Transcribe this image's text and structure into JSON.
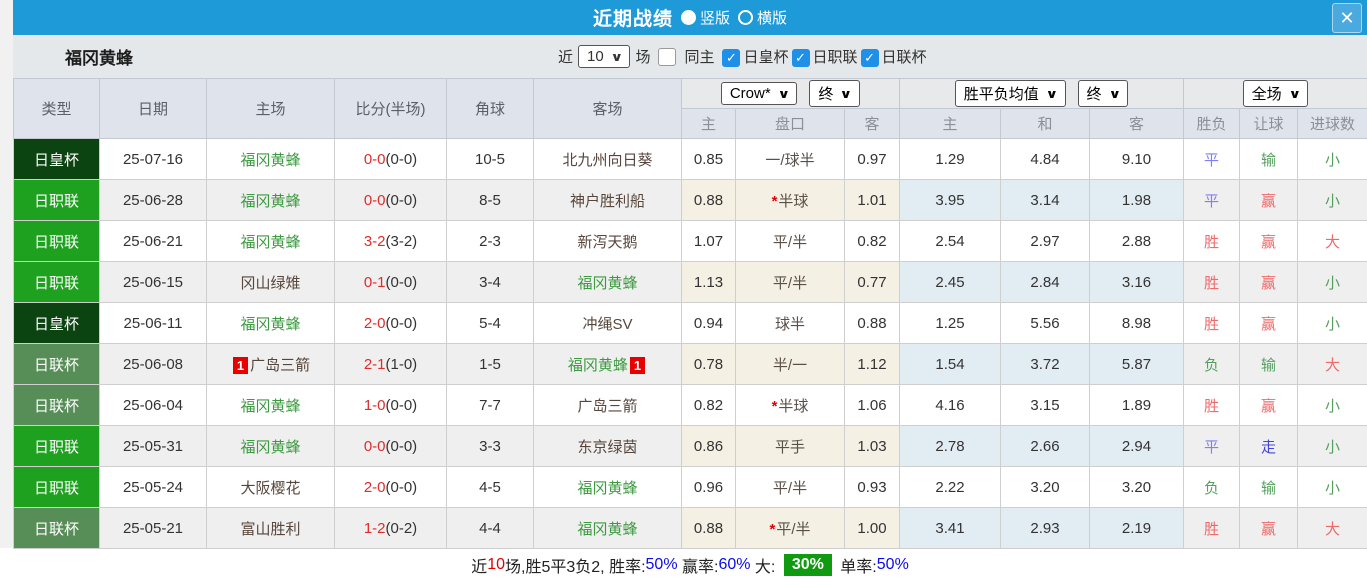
{
  "titlebar": {
    "title": "近期战绩",
    "radio_vertical": "竖版",
    "radio_horizontal": "横版",
    "close_icon": "✕"
  },
  "toolbar": {
    "team": "福冈黄蜂",
    "recent_label": "近",
    "count_value": "10",
    "matches_label": "场",
    "same_home_label": "同主",
    "filters": [
      {
        "label": "日皇杯",
        "checked": true
      },
      {
        "label": "日职联",
        "checked": true
      },
      {
        "label": "日联杯",
        "checked": true
      }
    ]
  },
  "table": {
    "left_headers": [
      "类型",
      "日期",
      "主场",
      "比分(半场)",
      "角球",
      "客场"
    ],
    "dropdowns": {
      "company": "Crow*",
      "company_time": "终",
      "europe": "胜平负均值",
      "europe_time": "终",
      "scope": "全场"
    },
    "sub_headers": [
      "主",
      "盘口",
      "客",
      "主",
      "和",
      "客",
      "胜负",
      "让球",
      "进球数"
    ],
    "badge_text": "1",
    "colors": {
      "cup_dark_badge": "#0b4410",
      "league_badge": "#1ea11e",
      "cup_light_badge": "#578e57",
      "self_team": "#3c9a40",
      "win_red": "#ef6a6a",
      "lose_green": "#55a05f",
      "draw_blue": "#8080f0",
      "push_purple": "#4444dd"
    },
    "rows": [
      {
        "type": "日皇杯",
        "type_class": "dark",
        "date": "25-07-16",
        "home": {
          "name": "福冈黄蜂",
          "self": true,
          "badge": false
        },
        "score": "0-0",
        "half": "(0-0)",
        "corner": "10-5",
        "away": {
          "name": "北九州向日葵",
          "self": false,
          "badge": false
        },
        "ah_home": "0.85",
        "ah_line": "一/球半",
        "ah_star": false,
        "ah_away": "0.97",
        "avg_home": "1.29",
        "avg_draw": "4.84",
        "avg_away": "9.10",
        "result": {
          "text": "平",
          "cls": "blue"
        },
        "handicap": {
          "text": "输",
          "cls": "green"
        },
        "goals": {
          "text": "小",
          "cls": "green"
        }
      },
      {
        "type": "日职联",
        "type_class": "bright",
        "date": "25-06-28",
        "home": {
          "name": "福冈黄蜂",
          "self": true,
          "badge": false
        },
        "score": "0-0",
        "half": "(0-0)",
        "corner": "8-5",
        "away": {
          "name": "神户胜利船",
          "self": false,
          "badge": false
        },
        "ah_home": "0.88",
        "ah_line": "半球",
        "ah_star": true,
        "ah_away": "1.01",
        "avg_home": "3.95",
        "avg_draw": "3.14",
        "avg_away": "1.98",
        "result": {
          "text": "平",
          "cls": "blue"
        },
        "handicap": {
          "text": "赢",
          "cls": "red"
        },
        "goals": {
          "text": "小",
          "cls": "green"
        }
      },
      {
        "type": "日职联",
        "type_class": "bright",
        "date": "25-06-21",
        "home": {
          "name": "福冈黄蜂",
          "self": true,
          "badge": false
        },
        "score": "3-2",
        "half": "(3-2)",
        "corner": "2-3",
        "away": {
          "name": "新泻天鹅",
          "self": false,
          "badge": false
        },
        "ah_home": "1.07",
        "ah_line": "平/半",
        "ah_star": false,
        "ah_away": "0.82",
        "avg_home": "2.54",
        "avg_draw": "2.97",
        "avg_away": "2.88",
        "result": {
          "text": "胜",
          "cls": "red"
        },
        "handicap": {
          "text": "赢",
          "cls": "red"
        },
        "goals": {
          "text": "大",
          "cls": "red"
        }
      },
      {
        "type": "日职联",
        "type_class": "bright",
        "date": "25-06-15",
        "home": {
          "name": "冈山绿雉",
          "self": false,
          "badge": false
        },
        "score": "0-1",
        "half": "(0-0)",
        "corner": "3-4",
        "away": {
          "name": "福冈黄蜂",
          "self": true,
          "badge": false
        },
        "ah_home": "1.13",
        "ah_line": "平/半",
        "ah_star": false,
        "ah_away": "0.77",
        "avg_home": "2.45",
        "avg_draw": "2.84",
        "avg_away": "3.16",
        "result": {
          "text": "胜",
          "cls": "red"
        },
        "handicap": {
          "text": "赢",
          "cls": "red"
        },
        "goals": {
          "text": "小",
          "cls": "green"
        }
      },
      {
        "type": "日皇杯",
        "type_class": "dark",
        "date": "25-06-11",
        "home": {
          "name": "福冈黄蜂",
          "self": true,
          "badge": false
        },
        "score": "2-0",
        "half": "(0-0)",
        "corner": "5-4",
        "away": {
          "name": "冲绳SV",
          "self": false,
          "badge": false
        },
        "ah_home": "0.94",
        "ah_line": "球半",
        "ah_star": false,
        "ah_away": "0.88",
        "avg_home": "1.25",
        "avg_draw": "5.56",
        "avg_away": "8.98",
        "result": {
          "text": "胜",
          "cls": "red"
        },
        "handicap": {
          "text": "赢",
          "cls": "red"
        },
        "goals": {
          "text": "小",
          "cls": "green"
        }
      },
      {
        "type": "日联杯",
        "type_class": "light",
        "date": "25-06-08",
        "home": {
          "name": "广岛三箭",
          "self": false,
          "badge": true
        },
        "score": "2-1",
        "half": "(1-0)",
        "corner": "1-5",
        "away": {
          "name": "福冈黄蜂",
          "self": true,
          "badge": true
        },
        "ah_home": "0.78",
        "ah_line": "半/一",
        "ah_star": false,
        "ah_away": "1.12",
        "avg_home": "1.54",
        "avg_draw": "3.72",
        "avg_away": "5.87",
        "result": {
          "text": "负",
          "cls": "green"
        },
        "handicap": {
          "text": "输",
          "cls": "green"
        },
        "goals": {
          "text": "大",
          "cls": "red"
        }
      },
      {
        "type": "日联杯",
        "type_class": "light",
        "date": "25-06-04",
        "home": {
          "name": "福冈黄蜂",
          "self": true,
          "badge": false
        },
        "score": "1-0",
        "half": "(0-0)",
        "corner": "7-7",
        "away": {
          "name": "广岛三箭",
          "self": false,
          "badge": false
        },
        "ah_home": "0.82",
        "ah_line": "半球",
        "ah_star": true,
        "ah_away": "1.06",
        "avg_home": "4.16",
        "avg_draw": "3.15",
        "avg_away": "1.89",
        "result": {
          "text": "胜",
          "cls": "red"
        },
        "handicap": {
          "text": "赢",
          "cls": "red"
        },
        "goals": {
          "text": "小",
          "cls": "green"
        }
      },
      {
        "type": "日职联",
        "type_class": "bright",
        "date": "25-05-31",
        "home": {
          "name": "福冈黄蜂",
          "self": true,
          "badge": false
        },
        "score": "0-0",
        "half": "(0-0)",
        "corner": "3-3",
        "away": {
          "name": "东京绿茵",
          "self": false,
          "badge": false
        },
        "ah_home": "0.86",
        "ah_line": "平手",
        "ah_star": false,
        "ah_away": "1.03",
        "avg_home": "2.78",
        "avg_draw": "2.66",
        "avg_away": "2.94",
        "result": {
          "text": "平",
          "cls": "blue"
        },
        "handicap": {
          "text": "走",
          "cls": "purple"
        },
        "goals": {
          "text": "小",
          "cls": "green"
        }
      },
      {
        "type": "日职联",
        "type_class": "bright",
        "date": "25-05-24",
        "home": {
          "name": "大阪樱花",
          "self": false,
          "badge": false
        },
        "score": "2-0",
        "half": "(0-0)",
        "corner": "4-5",
        "away": {
          "name": "福冈黄蜂",
          "self": true,
          "badge": false
        },
        "ah_home": "0.96",
        "ah_line": "平/半",
        "ah_star": false,
        "ah_away": "0.93",
        "avg_home": "2.22",
        "avg_draw": "3.20",
        "avg_away": "3.20",
        "result": {
          "text": "负",
          "cls": "green"
        },
        "handicap": {
          "text": "输",
          "cls": "green"
        },
        "goals": {
          "text": "小",
          "cls": "green"
        }
      },
      {
        "type": "日联杯",
        "type_class": "light",
        "date": "25-05-21",
        "home": {
          "name": "富山胜利",
          "self": false,
          "badge": false
        },
        "score": "1-2",
        "half": "(0-2)",
        "corner": "4-4",
        "away": {
          "name": "福冈黄蜂",
          "self": true,
          "badge": false
        },
        "ah_home": "0.88",
        "ah_line": "平/半",
        "ah_star": true,
        "ah_away": "1.00",
        "avg_home": "3.41",
        "avg_draw": "2.93",
        "avg_away": "2.19",
        "result": {
          "text": "胜",
          "cls": "red"
        },
        "handicap": {
          "text": "赢",
          "cls": "red"
        },
        "goals": {
          "text": "大",
          "cls": "red"
        }
      }
    ]
  },
  "footer": {
    "segments": [
      {
        "text": "近",
        "cls": "k"
      },
      {
        "text": "10",
        "cls": "red"
      },
      {
        "text": "场,胜5平3负2, ",
        "cls": "k"
      },
      {
        "text": "胜率:",
        "cls": "k"
      },
      {
        "text": "50%",
        "cls": "blue"
      },
      {
        "text": " 赢率:",
        "cls": "k"
      },
      {
        "text": "60%",
        "cls": "blue"
      },
      {
        "text": " 大: ",
        "cls": "k"
      },
      {
        "text": "30%",
        "cls": "green_badge"
      },
      {
        "text": " 单率:",
        "cls": "k"
      },
      {
        "text": "50%",
        "cls": "blue"
      }
    ]
  }
}
